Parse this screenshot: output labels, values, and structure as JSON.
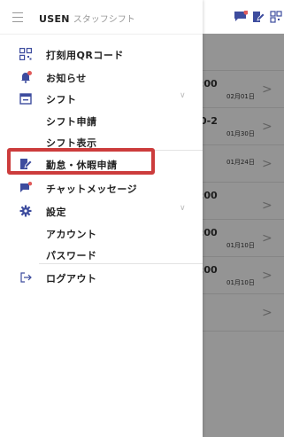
{
  "app": {
    "brand": "USEN",
    "subtitle": "スタッフシフト"
  },
  "menu": {
    "qr": "打刻用QRコード",
    "news": "お知らせ",
    "shift": "シフト",
    "shift_apply": "シフト申請",
    "shift_view": "シフト表示",
    "leave_apply": "勤怠・休暇申請",
    "chat": "チャットメッセージ",
    "settings": "設定",
    "account": "アカウント",
    "password": "パスワード",
    "logout": "ログアウト"
  },
  "background": {
    "rows": [
      {
        "time": ":00",
        "date": "02月01日"
      },
      {
        "time": "0-2",
        "date": "01月30日"
      },
      {
        "time": "",
        "date": "01月24日"
      },
      {
        "time": ":00",
        "date": ""
      },
      {
        "time": ":00",
        "date": "01月10日"
      },
      {
        "time": ":00",
        "date": "01月10日"
      },
      {
        "time": "",
        "date": ""
      }
    ]
  },
  "colors": {
    "accent": "#3d4c9e",
    "badge": "#e05a5a",
    "highlight": "#cc3c3c"
  },
  "icons": [
    "hamburger-icon",
    "qr-code-icon",
    "bell-icon",
    "calendar-icon",
    "leave-icon",
    "chat-icon",
    "gear-icon",
    "logout-icon",
    "chevron-right-icon",
    "chevron-down-icon"
  ]
}
